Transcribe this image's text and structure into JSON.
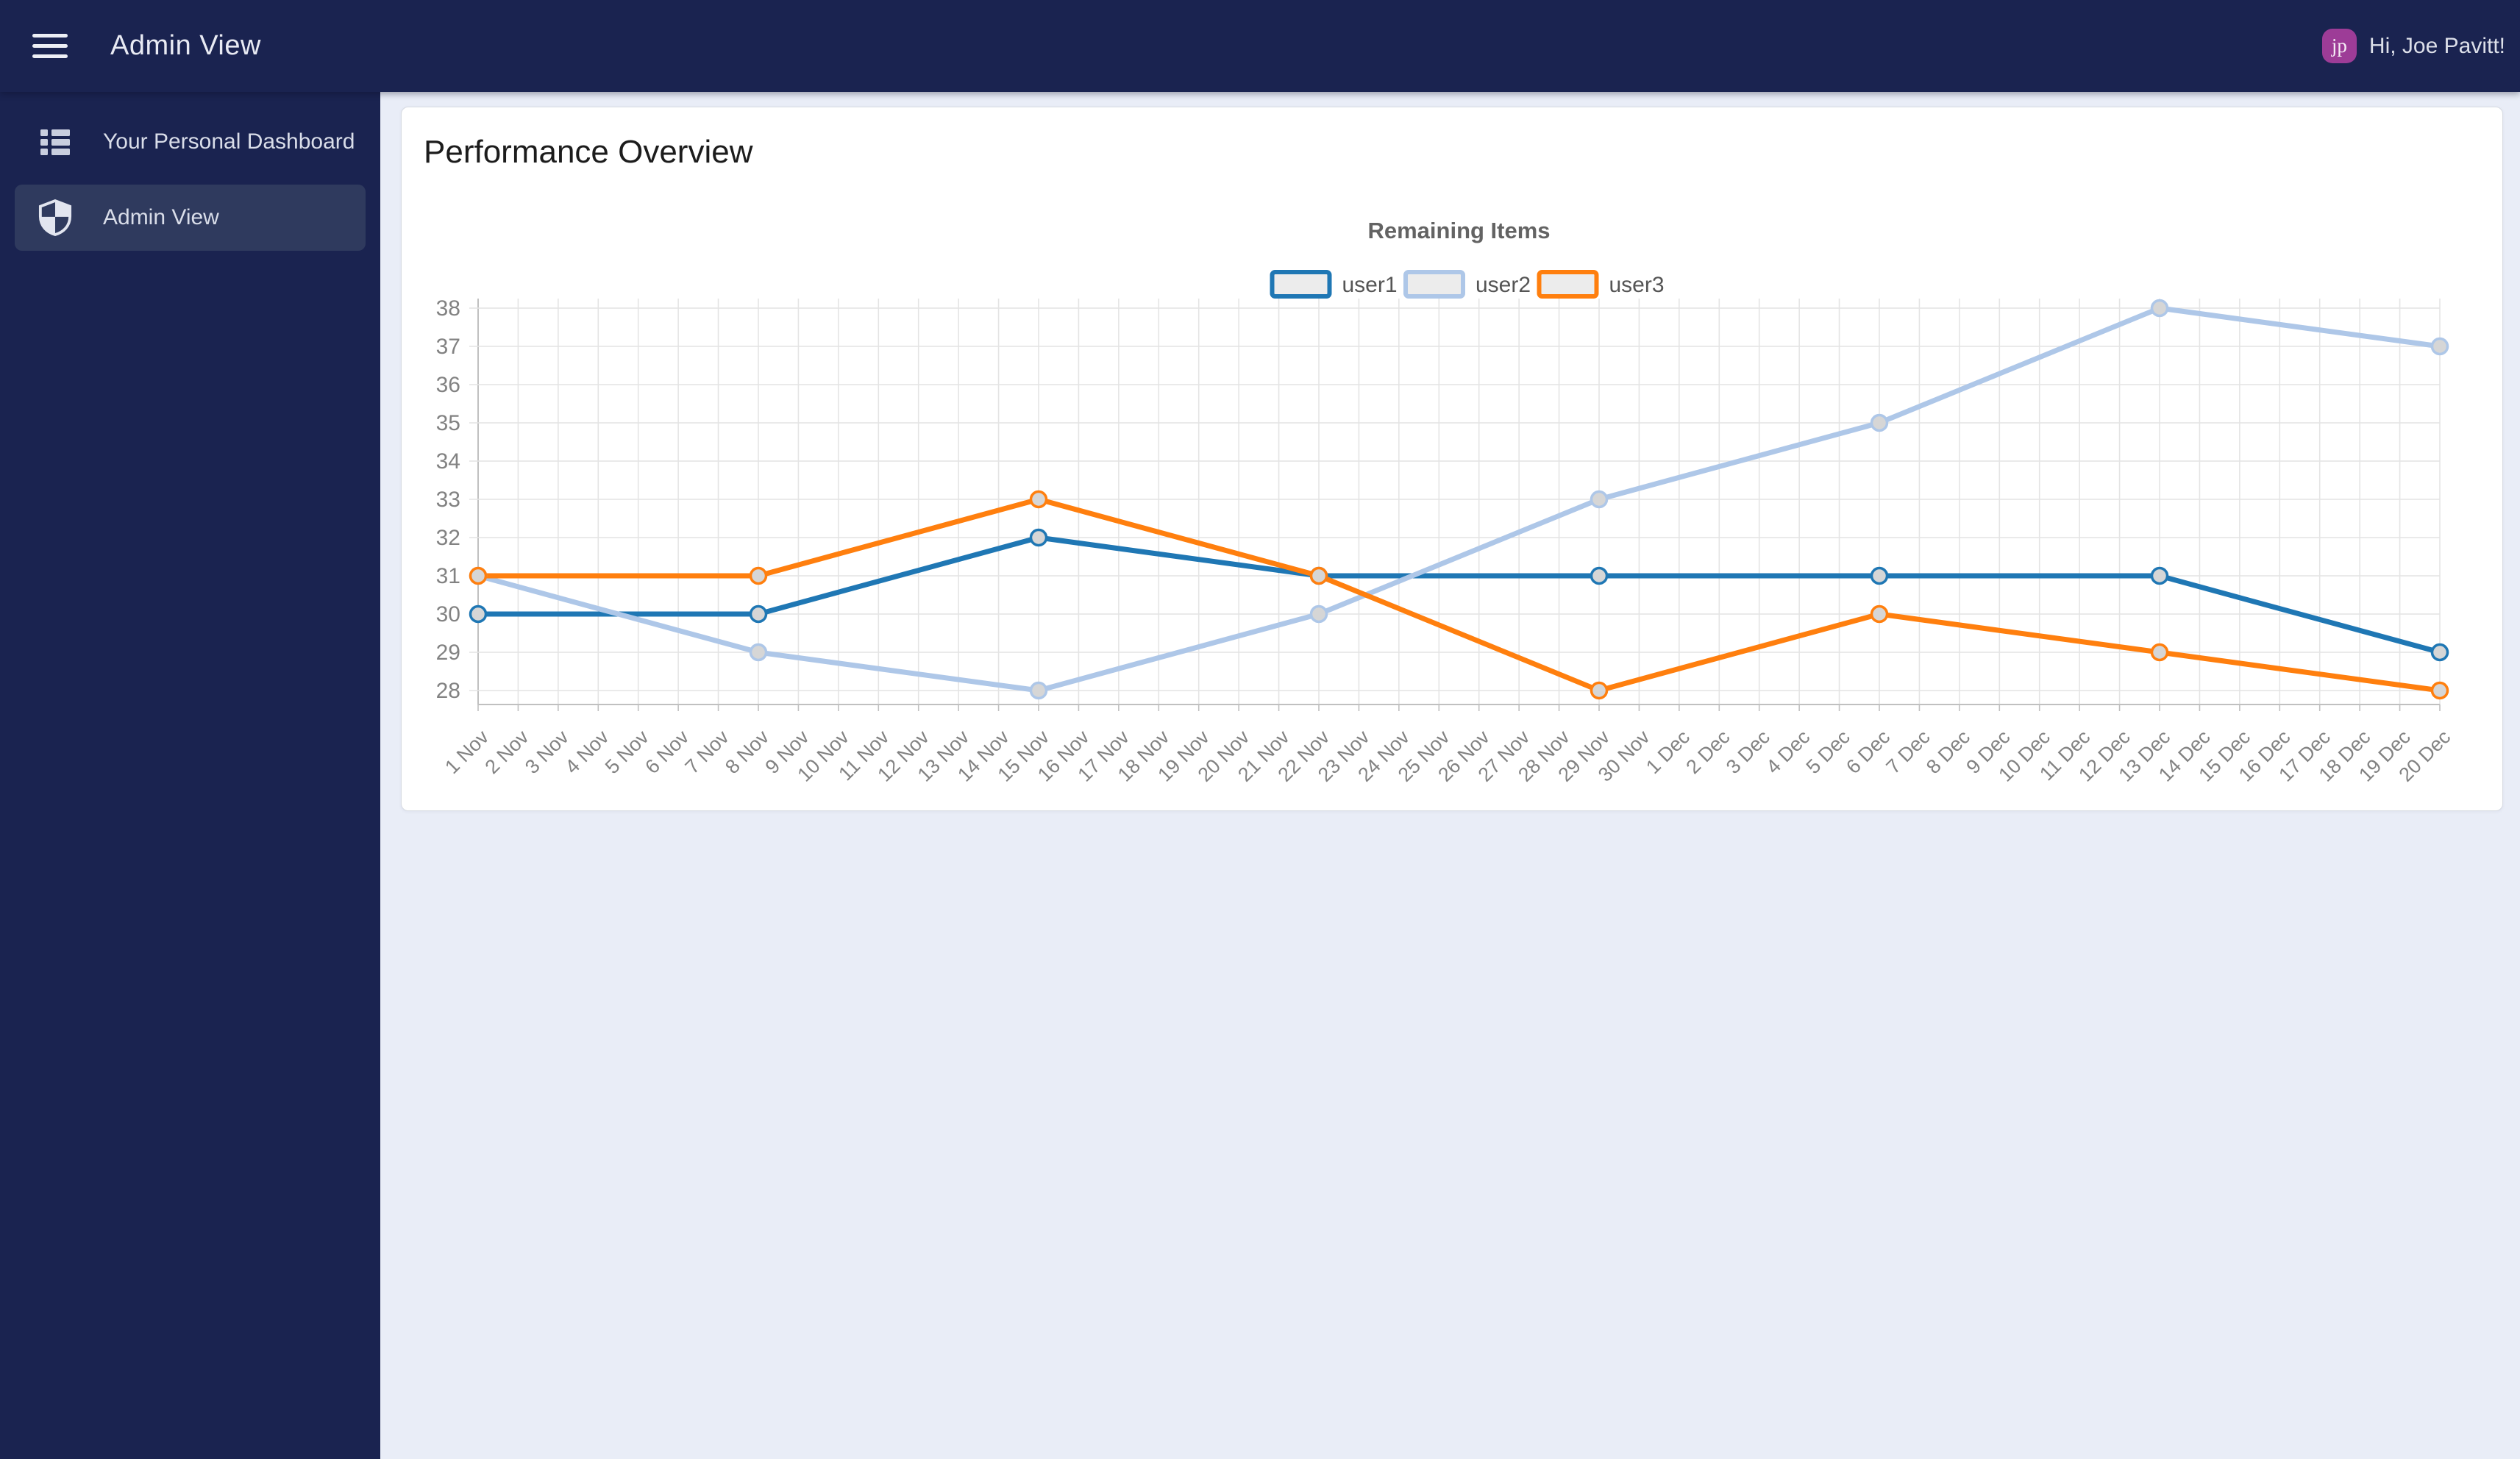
{
  "topbar": {
    "title": "Admin View",
    "greeting": "Hi, Joe Pavitt!",
    "avatar_initials": "jp",
    "avatar_color": "#9d3c97"
  },
  "sidebar": {
    "items": [
      {
        "label": "Your Personal Dashboard",
        "icon": "list-icon",
        "selected": false
      },
      {
        "label": "Admin View",
        "icon": "shield-icon",
        "selected": true
      }
    ]
  },
  "main": {
    "card_title": "Performance Overview"
  },
  "chart_data": {
    "type": "line",
    "title": "Remaining Items",
    "xlabel": "",
    "ylabel": "",
    "ylim": [
      28,
      38
    ],
    "y_ticks": [
      28,
      29,
      30,
      31,
      32,
      33,
      34,
      35,
      36,
      37,
      38
    ],
    "grid": true,
    "legend_position": "top-center",
    "x_labels": [
      "1 Nov",
      "2 Nov",
      "3 Nov",
      "4 Nov",
      "5 Nov",
      "6 Nov",
      "7 Nov",
      "8 Nov",
      "9 Nov",
      "10 Nov",
      "11 Nov",
      "12 Nov",
      "13 Nov",
      "14 Nov",
      "15 Nov",
      "16 Nov",
      "17 Nov",
      "18 Nov",
      "19 Nov",
      "20 Nov",
      "21 Nov",
      "22 Nov",
      "23 Nov",
      "24 Nov",
      "25 Nov",
      "26 Nov",
      "27 Nov",
      "28 Nov",
      "29 Nov",
      "30 Nov",
      "1 Dec",
      "2 Dec",
      "3 Dec",
      "4 Dec",
      "5 Dec",
      "6 Dec",
      "7 Dec",
      "8 Dec",
      "9 Dec",
      "10 Dec",
      "11 Dec",
      "12 Dec",
      "13 Dec",
      "14 Dec",
      "15 Dec",
      "16 Dec",
      "17 Dec",
      "18 Dec",
      "19 Dec",
      "20 Dec"
    ],
    "point_day_indices": [
      0,
      7,
      14,
      21,
      28,
      35,
      42,
      49
    ],
    "point_x_labels": [
      "1 Nov",
      "8 Nov",
      "15 Nov",
      "22 Nov",
      "29 Nov",
      "6 Dec",
      "13 Dec",
      "20 Dec"
    ],
    "series": [
      {
        "name": "user1",
        "color": "#1f77b4",
        "values": [
          30,
          30,
          32,
          31,
          31,
          31,
          31,
          29
        ]
      },
      {
        "name": "user2",
        "color": "#aec7e8",
        "values": [
          31,
          29,
          28,
          30,
          33,
          35,
          38,
          37
        ]
      },
      {
        "name": "user3",
        "color": "#ff7f0e",
        "values": [
          31,
          31,
          33,
          31,
          28,
          30,
          29,
          28
        ]
      }
    ],
    "legend_swatch_fill": "#ececec",
    "marker_fill": "#d6d6d6",
    "grid_color": "#e4e4e4",
    "axis_color": "#c0c0c0",
    "tick_label_color": "#828282",
    "title_color": "#636363",
    "legend_label_color": "#555555"
  }
}
